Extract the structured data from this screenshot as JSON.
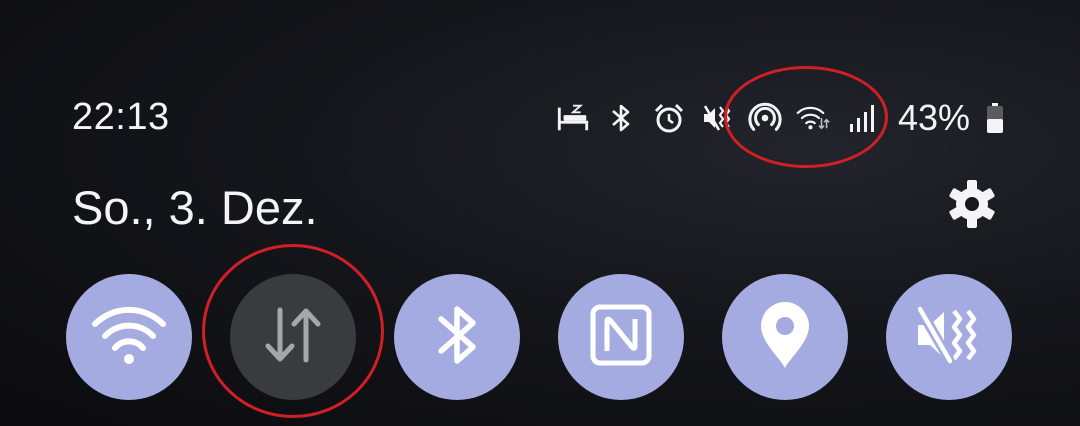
{
  "status_bar": {
    "time": "22:13",
    "icons": [
      "sleep-mode-icon",
      "bluetooth-icon",
      "alarm-icon",
      "vibrate-icon",
      "hotspot-icon",
      "wifi-data-icon",
      "signal-icon",
      "battery-icon"
    ],
    "battery_percent": "43%"
  },
  "header": {
    "date": "So., 3. Dez."
  },
  "quick_tiles": [
    {
      "name": "wifi",
      "icon": "wifi-icon",
      "state": "on"
    },
    {
      "name": "mobile-data",
      "icon": "data-transfer-icon",
      "state": "off"
    },
    {
      "name": "bluetooth",
      "icon": "bluetooth-icon",
      "state": "on"
    },
    {
      "name": "nfc",
      "icon": "nfc-icon",
      "state": "on"
    },
    {
      "name": "location",
      "icon": "location-pin-icon",
      "state": "on"
    },
    {
      "name": "sound-vibrate",
      "icon": "vibrate-mute-icon",
      "state": "on"
    }
  ],
  "colors": {
    "tile_active": "#a4abe0",
    "tile_inactive": "#3a3b3f",
    "annotation": "#d21f26",
    "background": "#121318"
  }
}
